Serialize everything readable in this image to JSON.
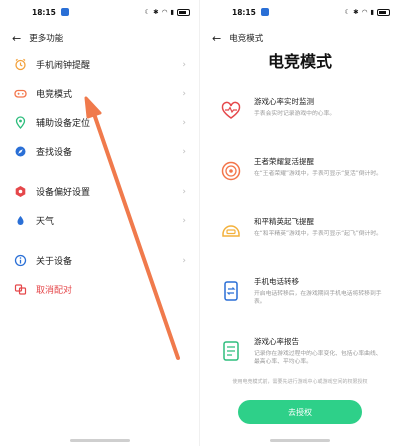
{
  "left": {
    "status": {
      "time": "18:15"
    },
    "header": {
      "back": "←",
      "title": "更多功能"
    },
    "menu": [
      {
        "name": "menu-alarm-sync",
        "icon": "alarm-icon",
        "glyph": "⏰",
        "color": "#f3a13b",
        "label": "手机闹钟提醒"
      },
      {
        "name": "menu-esports-mode",
        "icon": "gamepad-icon",
        "glyph": "🎮",
        "color": "#f3754a",
        "label": "电竞模式"
      },
      {
        "name": "menu-device-locate",
        "icon": "location-icon",
        "glyph": "📍",
        "color": "#2ebd7d",
        "label": "辅助设备定位"
      },
      {
        "name": "menu-find-device",
        "icon": "compass-icon",
        "glyph": "🧭",
        "color": "#2a6fd6",
        "label": "查找设备"
      },
      {
        "name": "menu-preferences",
        "icon": "hexagon-icon",
        "glyph": "⬢",
        "color": "#e5474a",
        "label": "设备偏好设置"
      },
      {
        "name": "menu-weather",
        "icon": "weather-icon",
        "glyph": "☁",
        "color": "#2a6fd6",
        "label": "天气"
      },
      {
        "name": "menu-about",
        "icon": "info-icon",
        "glyph": "ⓘ",
        "color": "#2a6fd6",
        "label": "关于设备"
      },
      {
        "name": "menu-unpair",
        "icon": "unpair-icon",
        "glyph": "⇄",
        "color": "#e5474a",
        "label": "取消配对"
      }
    ],
    "chevron": "›"
  },
  "right": {
    "status": {
      "time": "18:15"
    },
    "header": {
      "back": "←",
      "title": "电竞模式"
    },
    "title": "电竞模式",
    "features": [
      {
        "icon": "heart-icon",
        "color": "#e5474a",
        "name": "游戏心率实时监测",
        "desc": "手表会实时记录游戏中的心率。"
      },
      {
        "icon": "target-icon",
        "color": "#f3754a",
        "name": "王者荣耀复活提醒",
        "desc": "在“王者荣耀”游戏中，手表可显示“复活”倒计时。"
      },
      {
        "icon": "helmet-icon",
        "color": "#f3b13b",
        "name": "和平精英起飞提醒",
        "desc": "在“和平精英”游戏中，手表可显示“起飞”倒计时。"
      },
      {
        "icon": "phone-transfer-icon",
        "color": "#2a6fd6",
        "name": "手机电话转移",
        "desc": "开启电话转移后，在游戏期间手机电话将转移到手表。"
      },
      {
        "icon": "report-icon",
        "color": "#2ebd7d",
        "name": "游戏心率报告",
        "desc": "记录你在游戏过程中的心率变化、包括心率曲线、最高心率、平均心率。"
      }
    ],
    "note": "使用电竞模式前，需要先进行游戏中心或游戏空间的权限授权",
    "button_label": "去授权"
  }
}
